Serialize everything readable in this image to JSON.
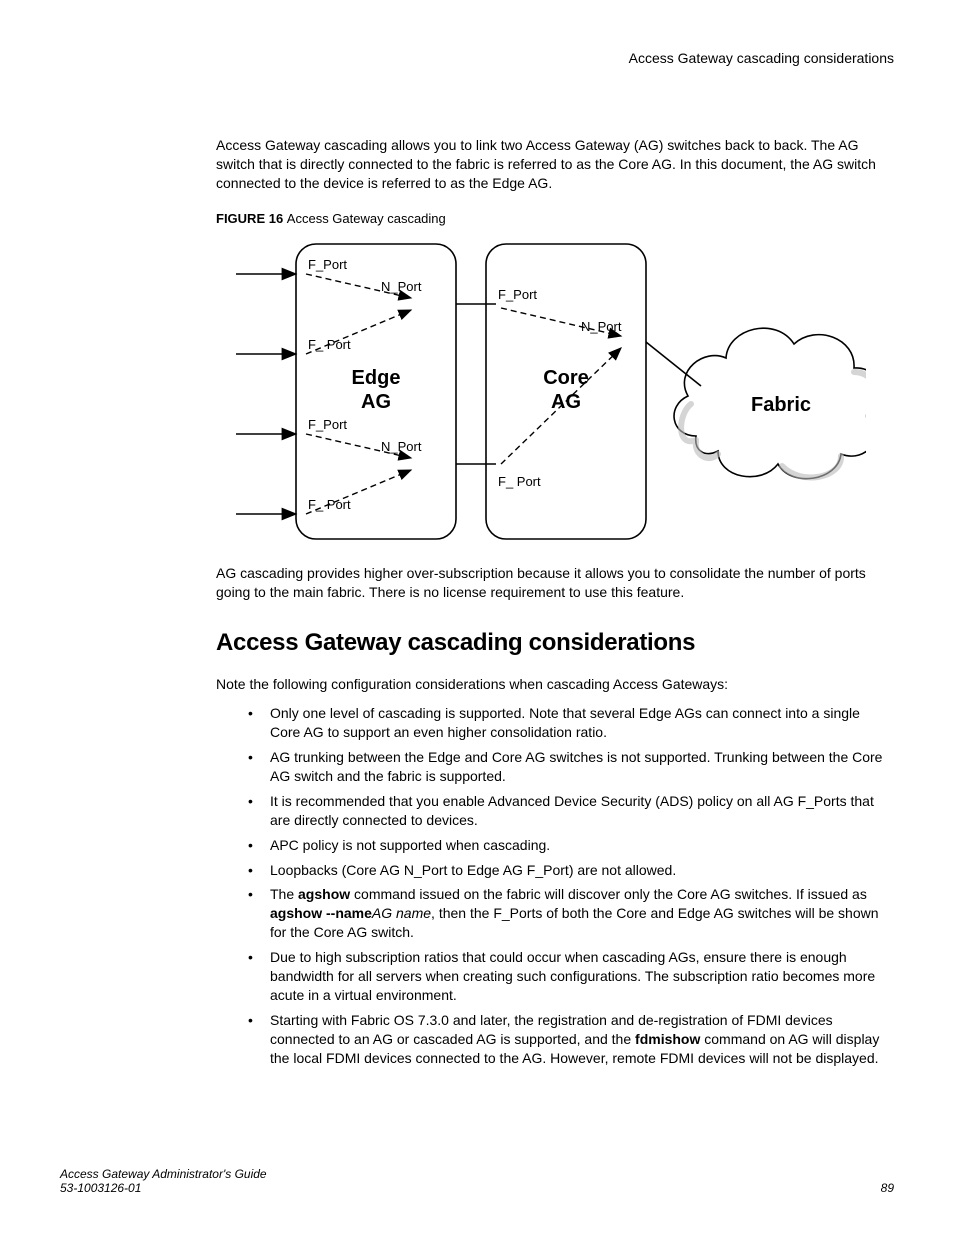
{
  "header": {
    "running_head": "Access Gateway cascading considerations"
  },
  "intro_para": "Access Gateway cascading allows you to link two Access Gateway (AG) switches back to back. The AG switch that is directly connected to the fabric is referred to as the Core AG. In this document, the AG switch connected to the device is referred to as the Edge AG.",
  "figure": {
    "label": "FIGURE 16 ",
    "title": "Access Gateway cascading",
    "edge_box": {
      "title_line1": "Edge",
      "title_line2": "AG",
      "ports": {
        "f_port_1": "F_Port",
        "n_port_1": "N_Port",
        "f_port_2": "F_ Port",
        "f_port_3": "F_Port",
        "n_port_2": "N_Port",
        "f_port_4": "F_ Port"
      }
    },
    "core_box": {
      "title_line1": "Core",
      "title_line2": "AG",
      "ports": {
        "f_port_1": "F_Port",
        "n_port_1": "N_Port",
        "f_port_2": "F_ Port"
      }
    },
    "fabric_label": "Fabric"
  },
  "after_fig_para": "AG cascading provides higher over-subscription because it allows you to consolidate the number of ports going to the main fabric. There is no license requirement to use this feature.",
  "section_heading": "Access Gateway cascading considerations",
  "lead_para": "Note the following configuration considerations when cascading Access Gateways:",
  "bullets": {
    "b1": "Only one level of cascading is supported. Note that several Edge AGs can connect into a single Core AG to support an even higher consolidation ratio.",
    "b2": "AG trunking between the Edge and Core AG switches is not supported. Trunking between the Core AG switch and the fabric is supported.",
    "b3": "It is recommended that you enable Advanced Device Security (ADS) policy on all AG F_Ports that are directly connected to devices.",
    "b4": "APC policy is not supported when cascading.",
    "b5": "Loopbacks (Core AG N_Port to Edge AG F_Port) are not allowed.",
    "b6_pre": "The ",
    "b6_cmd1": "agshow",
    "b6_mid": " command issued on the fabric will discover only the Core AG switches. If issued as ",
    "b6_cmd2": "agshow --name",
    "b6_arg": "AG name",
    "b6_post": ", then the F_Ports of both the Core and Edge AG switches will be shown for the Core AG switch.",
    "b7": "Due to high subscription ratios that could occur when cascading AGs, ensure there is enough bandwidth for all servers when creating such configurations. The subscription ratio becomes more acute in a virtual environment.",
    "b8_pre": "Starting with Fabric OS 7.3.0 and later, the registration and de-registration of FDMI devices connected to an AG or cascaded AG is supported, and the ",
    "b8_cmd": "fdmishow",
    "b8_post": " command on AG will display the local FDMI devices connected to the AG. However, remote FDMI devices will not be displayed."
  },
  "footer": {
    "guide": "Access Gateway Administrator's Guide",
    "docnum": "53-1003126-01",
    "page": "89"
  }
}
